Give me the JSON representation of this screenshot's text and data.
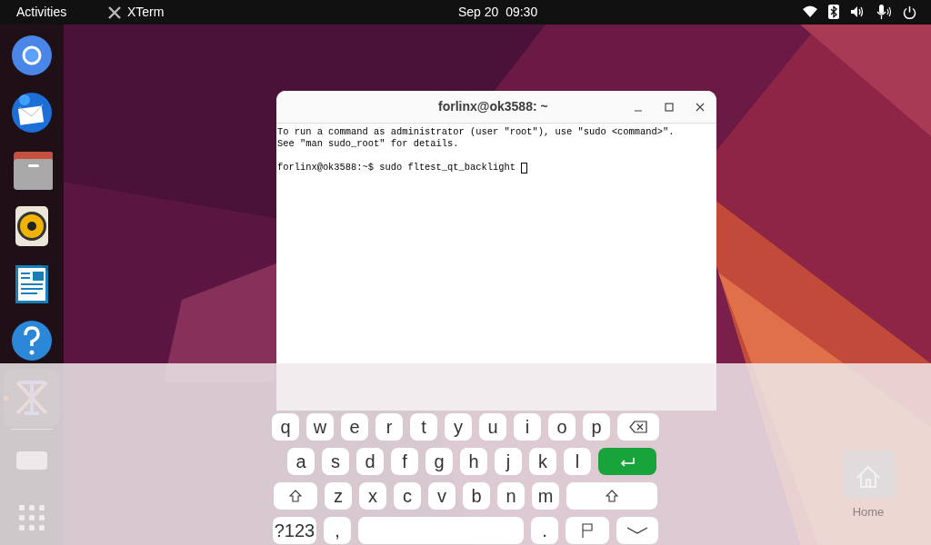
{
  "top_bar": {
    "activities": "Activities",
    "app_menu": "XTerm",
    "clock": "Sep 20  09:30"
  },
  "dock": {
    "items": [
      {
        "kind": "browser",
        "running": false
      },
      {
        "kind": "mail",
        "running": false
      },
      {
        "kind": "files",
        "running": false
      },
      {
        "kind": "music",
        "running": false
      },
      {
        "kind": "writer",
        "running": false
      },
      {
        "kind": "help",
        "running": false
      },
      {
        "kind": "terminal",
        "running": true
      },
      {
        "kind": "drive",
        "running": false
      },
      {
        "kind": "apps",
        "running": false
      }
    ]
  },
  "desktop_icons": [
    {
      "label": "Home"
    }
  ],
  "terminal": {
    "title": "forlinx@ok3588: ~",
    "blocks": [
      {
        "lines": [
          "To run a command as administrator (user \"root\"), use \"sudo <command>\".",
          "See \"man sudo_root\" for details."
        ]
      },
      {
        "lines": [
          "forlinx@ok3588:~$ sudo fltest_qt_backlight "
        ]
      }
    ]
  },
  "keyboard": {
    "rows": [
      {
        "keys": [
          {
            "kind": "char",
            "label": "q"
          },
          {
            "kind": "char",
            "label": "w"
          },
          {
            "kind": "char",
            "label": "e"
          },
          {
            "kind": "char",
            "label": "r"
          },
          {
            "kind": "char",
            "label": "t"
          },
          {
            "kind": "char",
            "label": "y"
          },
          {
            "kind": "char",
            "label": "u"
          },
          {
            "kind": "char",
            "label": "i"
          },
          {
            "kind": "char",
            "label": "o"
          },
          {
            "kind": "char",
            "label": "p"
          },
          {
            "kind": "backspace"
          }
        ]
      },
      {
        "keys": [
          {
            "kind": "char",
            "label": "a"
          },
          {
            "kind": "char",
            "label": "s"
          },
          {
            "kind": "char",
            "label": "d"
          },
          {
            "kind": "char",
            "label": "f"
          },
          {
            "kind": "char",
            "label": "g"
          },
          {
            "kind": "char",
            "label": "h"
          },
          {
            "kind": "char",
            "label": "j"
          },
          {
            "kind": "char",
            "label": "k"
          },
          {
            "kind": "char",
            "label": "l"
          },
          {
            "kind": "enter"
          }
        ]
      },
      {
        "keys": [
          {
            "kind": "shift"
          },
          {
            "kind": "char",
            "label": "z"
          },
          {
            "kind": "char",
            "label": "x"
          },
          {
            "kind": "char",
            "label": "c"
          },
          {
            "kind": "char",
            "label": "v"
          },
          {
            "kind": "char",
            "label": "b"
          },
          {
            "kind": "char",
            "label": "n"
          },
          {
            "kind": "char",
            "label": "m"
          },
          {
            "kind": "shift_wide"
          }
        ]
      },
      {
        "keys": [
          {
            "kind": "symbols",
            "label": "?123"
          },
          {
            "kind": "char",
            "label": ","
          },
          {
            "kind": "space"
          },
          {
            "kind": "char",
            "label": "."
          },
          {
            "kind": "lang"
          },
          {
            "kind": "hide"
          }
        ]
      }
    ]
  }
}
